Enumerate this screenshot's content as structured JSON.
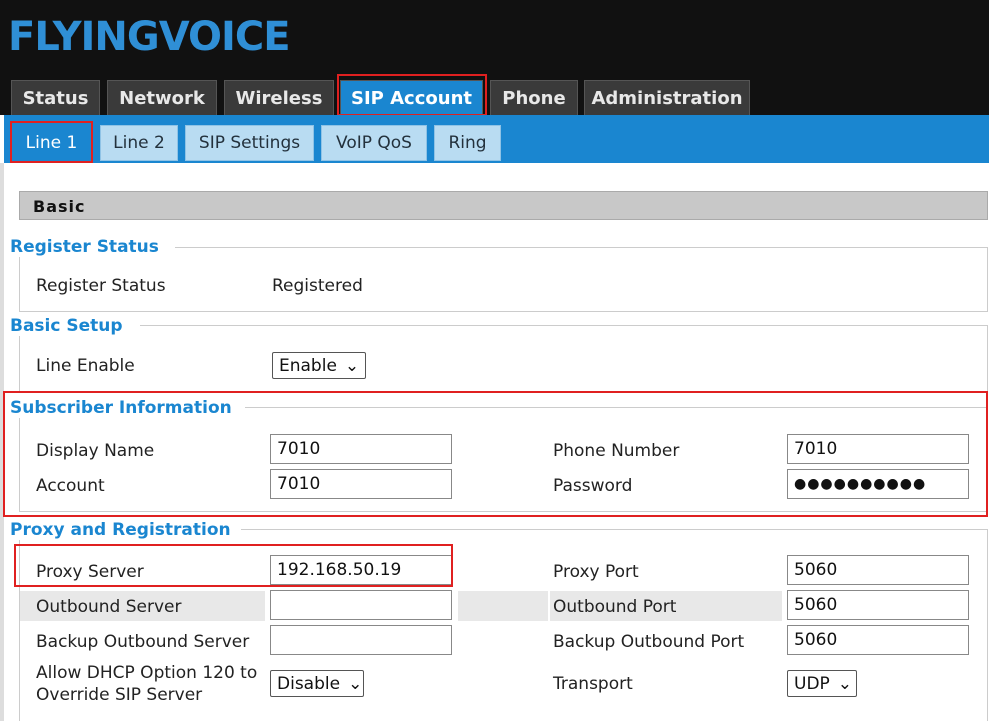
{
  "brand": {
    "logo_text": "FLYINGVOICE"
  },
  "main_tabs": [
    "Status",
    "Network",
    "Wireless",
    "SIP Account",
    "Phone",
    "Administration"
  ],
  "sub_tabs": [
    "Line 1",
    "Line 2",
    "SIP Settings",
    "VoIP QoS",
    "Ring"
  ],
  "basic_header": "Basic",
  "register_status": {
    "title": "Register Status",
    "label": "Register Status",
    "value": "Registered"
  },
  "basic_setup": {
    "title": "Basic Setup",
    "line_enable_label": "Line Enable",
    "line_enable_value": "Enable"
  },
  "subscriber": {
    "title": "Subscriber Information",
    "display_name_label": "Display Name",
    "display_name_value": "7010",
    "phone_number_label": "Phone Number",
    "phone_number_value": "7010",
    "account_label": "Account",
    "account_value": "7010",
    "password_label": "Password",
    "password_value": "●●●●●●●●●●"
  },
  "proxy": {
    "title": "Proxy and Registration",
    "proxy_server_label": "Proxy Server",
    "proxy_server_value": "192.168.50.19",
    "proxy_port_label": "Proxy Port",
    "proxy_port_value": "5060",
    "outbound_server_label": "Outbound Server",
    "outbound_server_value": "",
    "outbound_port_label": "Outbound Port",
    "outbound_port_value": "5060",
    "backup_outbound_server_label": "Backup Outbound Server",
    "backup_outbound_server_value": "",
    "backup_outbound_port_label": "Backup Outbound Port",
    "backup_outbound_port_value": "5060",
    "dhcp_label_line1": "Allow DHCP Option 120 to",
    "dhcp_label_line2": "Override SIP Server",
    "dhcp_value": "Disable",
    "transport_label": "Transport",
    "transport_value": "UDP"
  },
  "colors": {
    "accent": "#1a86d0",
    "highlight": "#e02020",
    "header_bg": "#111111"
  }
}
